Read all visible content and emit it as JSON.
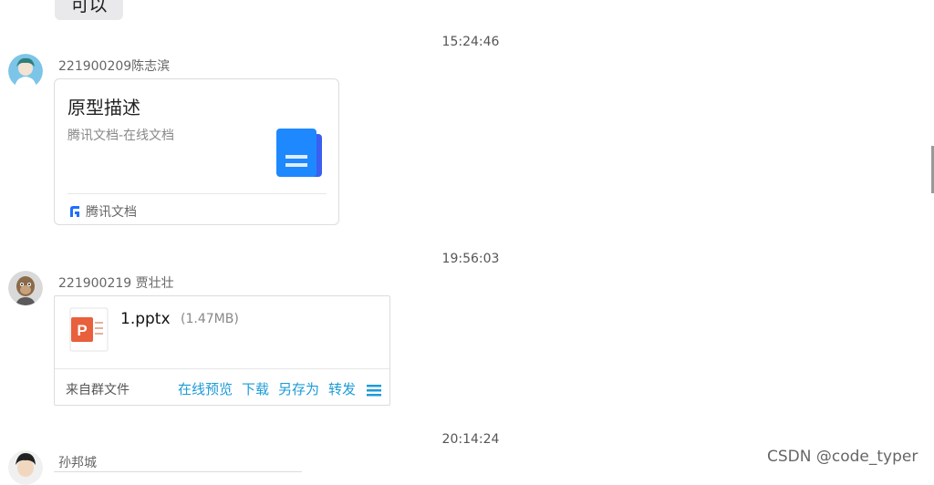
{
  "top_message": {
    "text": "可以"
  },
  "messages": [
    {
      "timestamp": "15:24:46",
      "sender": "221900209陈志滨",
      "doc_card": {
        "title": "原型描述",
        "subtitle": "腾讯文档-在线文档",
        "source": "腾讯文档",
        "icon": "tencent-docs-file-icon"
      }
    },
    {
      "timestamp": "19:56:03",
      "sender": "221900219 贾壮壮",
      "file_card": {
        "file_name": "1.pptx",
        "file_size": "(1.47MB)",
        "from_label": "来自群文件",
        "actions": [
          "在线预览",
          "下载",
          "另存为",
          "转发"
        ],
        "file_icon": "powerpoint-file-icon",
        "menu_icon": "menu-icon"
      }
    },
    {
      "timestamp": "20:14:24",
      "sender": "孙邦城"
    }
  ],
  "watermark": "CSDN @code_typer",
  "colors": {
    "accent": "#1d9bd8",
    "doc_blue": "#1e6fff",
    "ppt_orange": "#e8603c"
  }
}
